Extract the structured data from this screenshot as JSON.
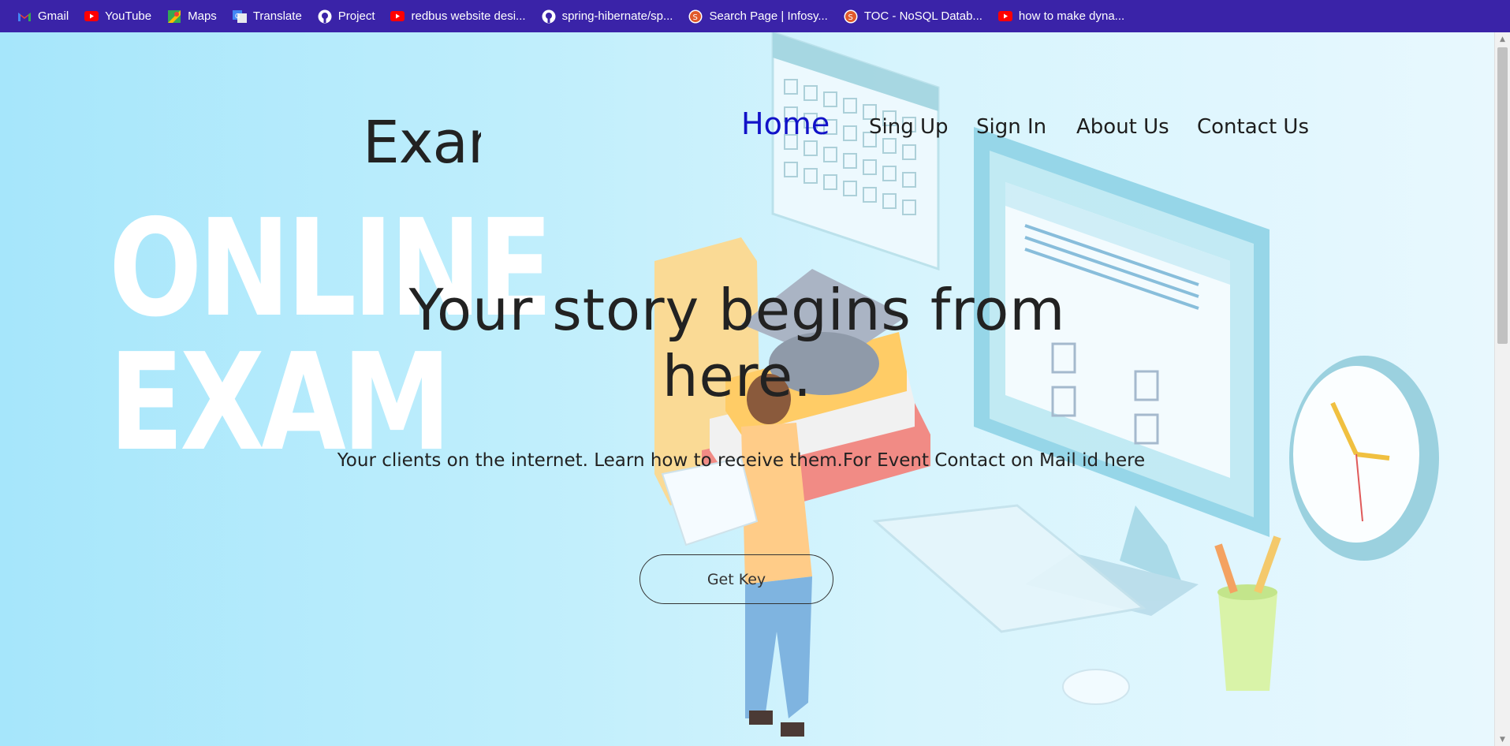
{
  "bookmarks": [
    {
      "label": "Gmail",
      "icon": "gmail-icon",
      "color": "#ea4335"
    },
    {
      "label": "YouTube",
      "icon": "youtube-icon",
      "color": "#ff0000"
    },
    {
      "label": "Maps",
      "icon": "maps-icon",
      "color": "#34a853"
    },
    {
      "label": "Translate",
      "icon": "translate-icon",
      "color": "#4285f4"
    },
    {
      "label": "Project",
      "icon": "github-icon",
      "color": "#ffffff"
    },
    {
      "label": "redbus website desi...",
      "icon": "youtube-icon",
      "color": "#ff0000"
    },
    {
      "label": "spring-hibernate/sp...",
      "icon": "github-icon",
      "color": "#ffffff"
    },
    {
      "label": "Search Page | Infosy...",
      "icon": "infosys-icon",
      "color": "#5b6ee1"
    },
    {
      "label": "TOC - NoSQL Datab...",
      "icon": "infosys-icon",
      "color": "#5b6ee1"
    },
    {
      "label": "how to make dyna...",
      "icon": "youtube-icon",
      "color": "#ff0000"
    }
  ],
  "header": {
    "logo": "Exam",
    "nav": [
      {
        "label": "Home",
        "active": true
      },
      {
        "label": "Sing Up",
        "active": false
      },
      {
        "label": "Sign In",
        "active": false
      },
      {
        "label": "About Us",
        "active": false
      },
      {
        "label": "Contact Us",
        "active": false
      }
    ]
  },
  "hero": {
    "background_text_line1": "ONLINE",
    "background_text_line2": "EXAM",
    "headline": "Your story begins from here.",
    "subline": "Your clients on the internet. Learn how to receive them.For Event Contact on Mail id here",
    "button": "Get Key"
  },
  "colors": {
    "bookmark_bar": "#3a23a8",
    "nav_active": "#1212c8",
    "text": "#222222"
  }
}
